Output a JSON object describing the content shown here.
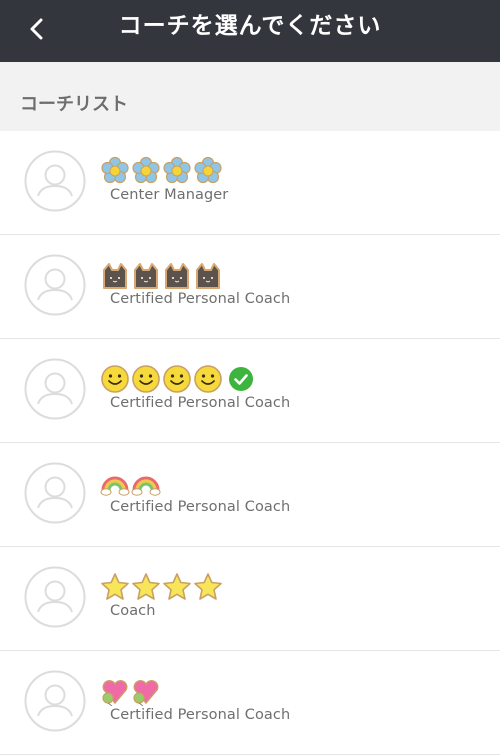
{
  "header": {
    "title": "コーチを選んでください",
    "back_icon": "chevron-left-icon"
  },
  "section": {
    "title": "コーチリスト"
  },
  "coaches": [
    {
      "stickers": [
        "flower",
        "flower",
        "flower",
        "flower"
      ],
      "verified": false,
      "role": "Center Manager"
    },
    {
      "stickers": [
        "cat",
        "cat",
        "cat",
        "cat"
      ],
      "verified": false,
      "role": "Certified Personal Coach"
    },
    {
      "stickers": [
        "smiley",
        "smiley",
        "smiley",
        "smiley"
      ],
      "verified": true,
      "role": "Certified Personal Coach"
    },
    {
      "stickers": [
        "rainbow",
        "rainbow"
      ],
      "verified": false,
      "role": "Certified Personal Coach"
    },
    {
      "stickers": [
        "star",
        "star",
        "star",
        "star"
      ],
      "verified": false,
      "role": "Coach"
    },
    {
      "stickers": [
        "heart-balloon",
        "heart-balloon"
      ],
      "verified": false,
      "role": "Certified Personal Coach"
    }
  ],
  "colors": {
    "header_bg": "#33363c",
    "section_bg": "#f2f2f2",
    "role_text": "#6f6f6f",
    "verified_green": "#3db43d"
  }
}
